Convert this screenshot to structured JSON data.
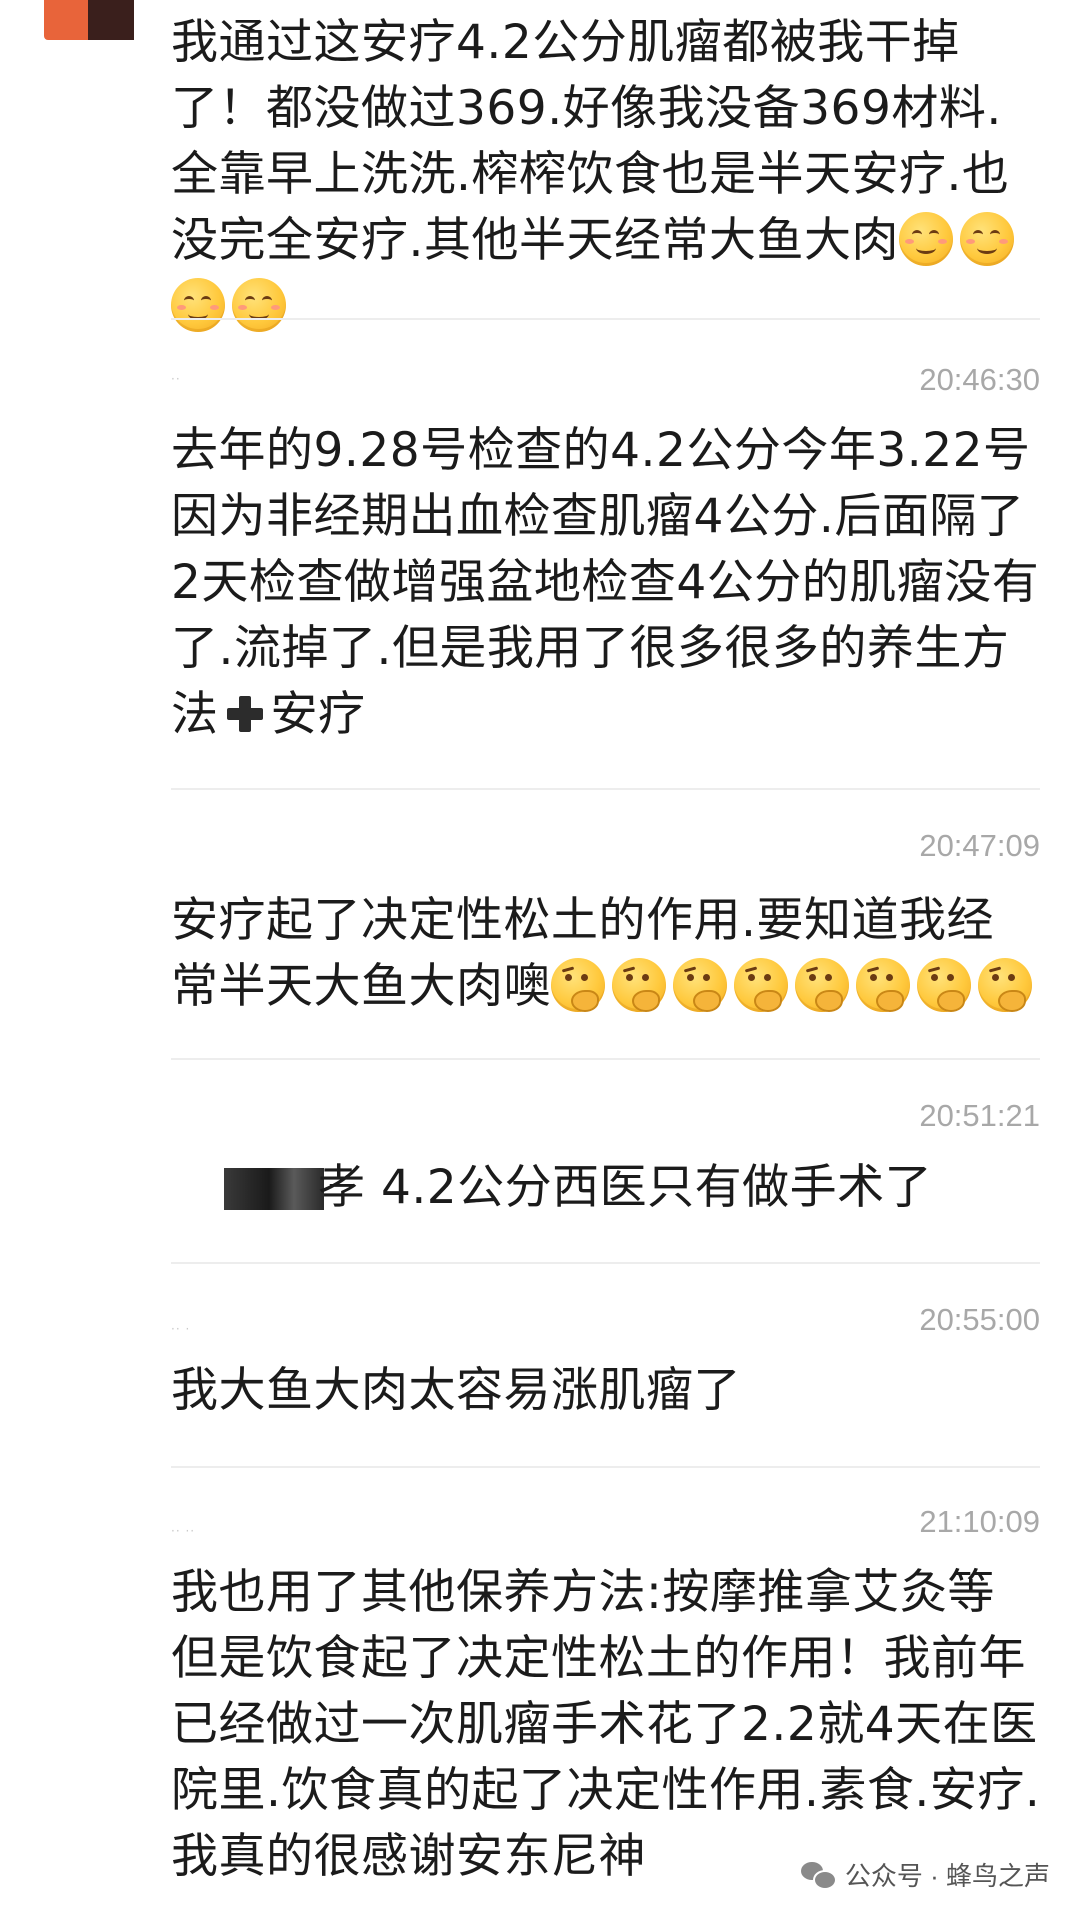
{
  "messages": [
    {
      "id": "m1",
      "time": "",
      "text": "我通过这安疗4.2公分肌瘤都被我干掉了！都没做过369.好像我没备369材料.全靠早上洗洗.榨榨饮食也是半天安疗.也没完全安疗.其他半天经常大鱼大肉",
      "trailing_emoji": "smiling-face-emoji",
      "emoji_count": 4
    },
    {
      "id": "m2",
      "time": "20:46:30",
      "text": "去年的9.28号检查的4.2公分今年3.22号因为非经期出血检查肌瘤4公分.后面隔了2天检查做增强盆地检查4公分的肌瘤没有了.流掉了.但是我用了很多很多的养生方法",
      "after_plus": "安疗",
      "inline_icon": "heavy-plus-icon"
    },
    {
      "id": "m3",
      "time": "20:47:09",
      "text": "安疗起了决定性松土的作用.要知道我经常半天大鱼大肉噢",
      "trailing_emoji": "thinking-face-emoji",
      "emoji_count": 8
    },
    {
      "id": "m4",
      "time": "20:51:21",
      "text": "孝 4.2公分西医只有做手术了"
    },
    {
      "id": "m5",
      "time": "20:55:00",
      "text": "我大鱼大肉太容易涨肌瘤了"
    },
    {
      "id": "m6",
      "time": "21:10:09",
      "text": "我也用了其他保养方法:按摩推拿艾灸等但是饮食起了决定性松土的作用！我前年已经做过一次肌瘤手术花了2.2就4天在医院里.饮食真的起了决定性作用.素食.安疗.我真的很感谢安东尼神"
    }
  ],
  "watermark": {
    "icon": "wechat-icon",
    "text": "公众号 · 蜂鸟之声"
  }
}
